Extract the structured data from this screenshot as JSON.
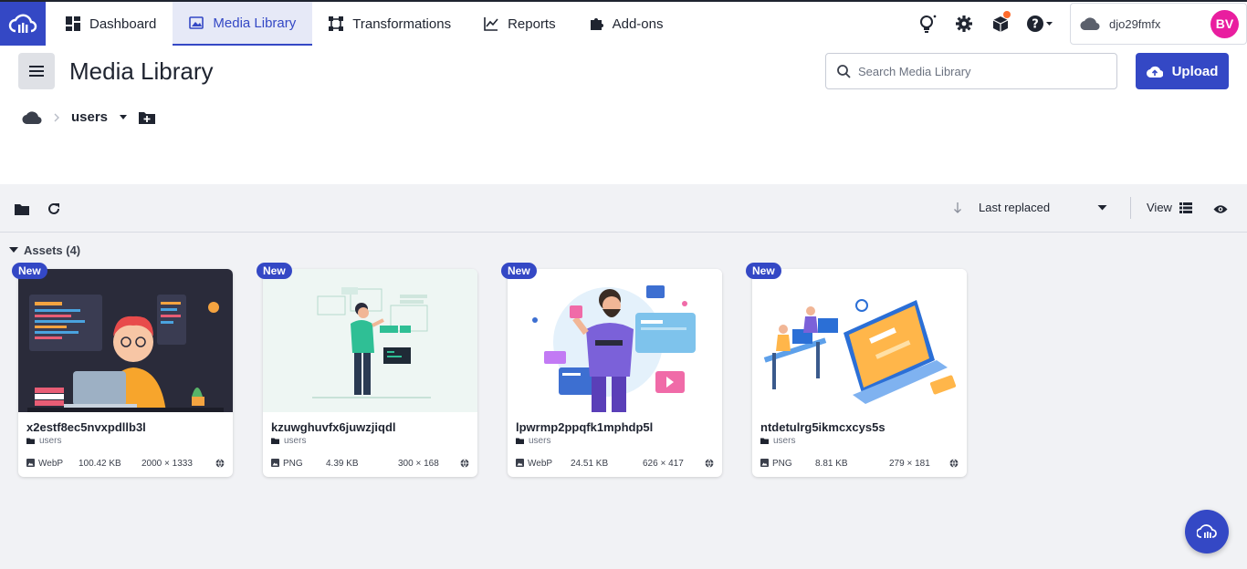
{
  "nav": {
    "items": [
      {
        "label": "Dashboard",
        "icon": "dashboard-icon"
      },
      {
        "label": "Media Library",
        "icon": "image-icon"
      },
      {
        "label": "Transformations",
        "icon": "transform-icon"
      },
      {
        "label": "Reports",
        "icon": "chart-icon"
      },
      {
        "label": "Add-ons",
        "icon": "puzzle-icon"
      }
    ],
    "active": "Media Library"
  },
  "account": {
    "cloud_name": "djo29fmfx",
    "avatar_initials": "BV"
  },
  "header": {
    "title": "Media Library",
    "search_placeholder": "Search Media Library",
    "upload_label": "Upload"
  },
  "breadcrumb": {
    "folder": "users"
  },
  "toolbar": {
    "sort_label": "Last replaced",
    "view_label": "View"
  },
  "assets": {
    "heading": "Assets (4)",
    "items": [
      {
        "badge": "New",
        "name": "x2estf8ec5nvxpdllb3l",
        "folder": "users",
        "format": "WebP",
        "size": "100.42 KB",
        "dimensions": "2000 × 1333"
      },
      {
        "badge": "New",
        "name": "kzuwghuvfx6juwzjiqdl",
        "folder": "users",
        "format": "PNG",
        "size": "4.39 KB",
        "dimensions": "300 × 168"
      },
      {
        "badge": "New",
        "name": "lpwrmp2ppqfk1mphdp5l",
        "folder": "users",
        "format": "WebP",
        "size": "24.51 KB",
        "dimensions": "626 × 417"
      },
      {
        "badge": "New",
        "name": "ntdetulrg5ikmcxcys5s",
        "folder": "users",
        "format": "PNG",
        "size": "8.81 KB",
        "dimensions": "279 × 181"
      }
    ]
  },
  "colors": {
    "brand": "#3448c5",
    "avatar": "#e91e9f",
    "notification": "#ff6b2b"
  }
}
